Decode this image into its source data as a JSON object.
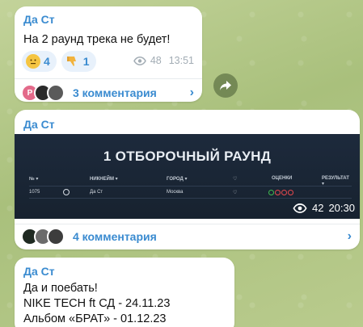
{
  "messages": [
    {
      "author": "Да Ст",
      "text": "На 2 раунд трека не будет!",
      "reactions": [
        {
          "emoji": "neutral-face",
          "count": "4"
        },
        {
          "emoji": "thumbs-down",
          "count": "1"
        }
      ],
      "views": "48",
      "time": "13:51",
      "comments_label": "3 комментария",
      "avatar_letter": "P"
    },
    {
      "author": "Да Ст",
      "image": {
        "title": "1 ОТБОРОЧНЫЙ РАУНД",
        "headers": {
          "num": "№ ▾",
          "nick": "НИКНЕЙМ ▾",
          "city": "ГОРОД ▾",
          "like": "♡",
          "scores": "ОЦЕНКИ",
          "result": "РЕЗУЛЬТАТ ▾"
        },
        "row": {
          "num": "1075",
          "nick": "Да Ст",
          "city": "Москва",
          "like": "♡"
        }
      },
      "views": "42",
      "time": "20:30",
      "comments_label": "4 комментария"
    },
    {
      "author": "Да Ст",
      "lines": [
        "Да и поебать!",
        "NIKE TECH ft СД - 24.11.23",
        "Альбом «БРАТ» - 01.12.23"
      ]
    }
  ],
  "colors": {
    "accent": "#3a8bd0",
    "reaction_bg": "#e8f1fb",
    "score_ok": "#3fb950",
    "score_bad": "#e5484d"
  }
}
